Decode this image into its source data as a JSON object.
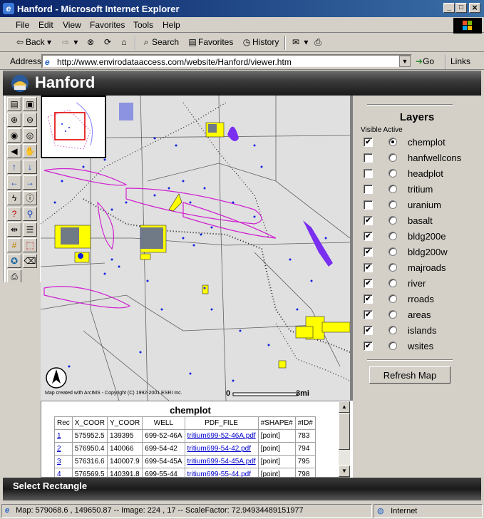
{
  "window": {
    "title": "Hanford - Microsoft Internet Explorer",
    "min": "_",
    "max": "□",
    "close": "×"
  },
  "menu": [
    "File",
    "Edit",
    "View",
    "Favorites",
    "Tools",
    "Help"
  ],
  "toolbar": {
    "back": "Back",
    "search": "Search",
    "favorites": "Favorites",
    "history": "History"
  },
  "address": {
    "label": "Address",
    "url": "http://www.envirodataaccess.com/website/Hanford/viewer.htm",
    "go": "Go",
    "links": "Links"
  },
  "banner": {
    "title": "Hanford"
  },
  "map": {
    "north": "N",
    "copyright": "Map created with ArcIMS - Copyright (C) 1992-2001 ESRI Inc.",
    "scale_start": "0",
    "scale_end": "3mi"
  },
  "layers": {
    "title": "Layers",
    "subtitle": "Visible Active",
    "refresh": "Refresh Map",
    "items": [
      {
        "name": "chemplot",
        "visible": true,
        "active": true
      },
      {
        "name": "hanfwellcons",
        "visible": false,
        "active": false
      },
      {
        "name": "headplot",
        "visible": false,
        "active": false
      },
      {
        "name": "tritium",
        "visible": false,
        "active": false
      },
      {
        "name": "uranium",
        "visible": false,
        "active": false
      },
      {
        "name": "basalt",
        "visible": true,
        "active": false
      },
      {
        "name": "bldg200e",
        "visible": true,
        "active": false
      },
      {
        "name": "bldg200w",
        "visible": true,
        "active": false
      },
      {
        "name": "majroads",
        "visible": true,
        "active": false
      },
      {
        "name": "river",
        "visible": true,
        "active": false
      },
      {
        "name": "rroads",
        "visible": true,
        "active": false
      },
      {
        "name": "areas",
        "visible": true,
        "active": false
      },
      {
        "name": "islands",
        "visible": true,
        "active": false
      },
      {
        "name": "wsites",
        "visible": true,
        "active": false
      }
    ]
  },
  "table": {
    "title": "chemplot",
    "columns": [
      "Rec",
      "X_COOR",
      "Y_COOR",
      "WELL",
      "PDF_FILE",
      "#SHAPE#",
      "#ID#"
    ],
    "rows": [
      [
        "1",
        "575952.5",
        "139395",
        "699-52-46A",
        "tritium699-52-46A.pdf",
        "[point]",
        "783"
      ],
      [
        "2",
        "576950.4",
        "140066",
        "699-54-42",
        "tritium699-54-42.pdf",
        "[point]",
        "794"
      ],
      [
        "3",
        "576316.6",
        "140007.9",
        "699-54-45A",
        "tritium699-54-45A.pdf",
        "[point]",
        "795"
      ],
      [
        "4",
        "576569.5",
        "140391.8",
        "699-55-44",
        "tritium699-55-44.pdf",
        "[point]",
        "798"
      ]
    ]
  },
  "mode": {
    "label": "Select Rectangle"
  },
  "status": {
    "text": "Map: 579068.6 , 149650.87 -- Image: 224 , 17 -- ScaleFactor: 72.94934489151977",
    "zone": "Internet"
  }
}
